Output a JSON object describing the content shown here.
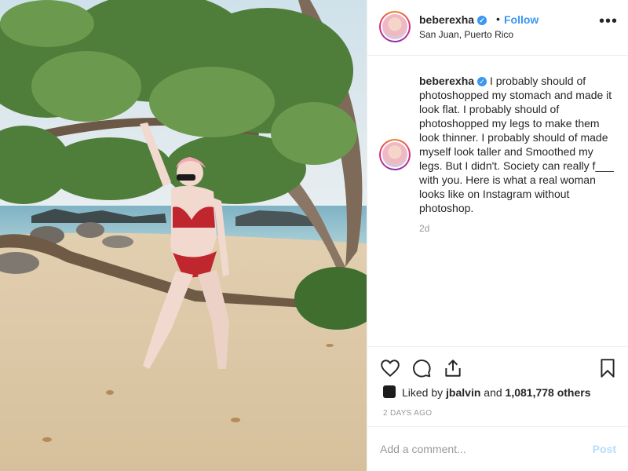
{
  "post": {
    "photo": {
      "alt": "photo-icon"
    },
    "header": {
      "username": "beberexha",
      "verified_icon": "verified-badge-icon",
      "separator": "•",
      "follow_label": "Follow",
      "location": "San Juan, Puerto Rico",
      "more_icon": "more-options-icon",
      "more_glyph": "•••"
    },
    "caption": {
      "username": "beberexha",
      "text": "I probably should of photoshopped my stomach and made it look flat. I probably should of photoshopped my legs to make them look thinner. I probably should of made myself look taller and Smoothed my legs. But I didn't. Society can really f___ with you. Here is what a real woman looks like on Instagram without photoshop.",
      "time": "2d"
    },
    "actions": {
      "icons": [
        "heart-icon",
        "comment-icon",
        "share-icon",
        "bookmark-icon"
      ],
      "liked_by_prefix": "Liked by ",
      "liked_by_user": "jbalvin",
      "liked_by_middle": " and ",
      "liked_by_count": "1,081,778 others",
      "time_ago": "2 DAYS AGO"
    },
    "comment": {
      "placeholder": "Add a comment...",
      "post_label": "Post"
    },
    "colors": {
      "accent": "#3897f0",
      "muted": "#999999",
      "post_disabled": "#b9dcfa",
      "divider": "#efefef"
    }
  }
}
